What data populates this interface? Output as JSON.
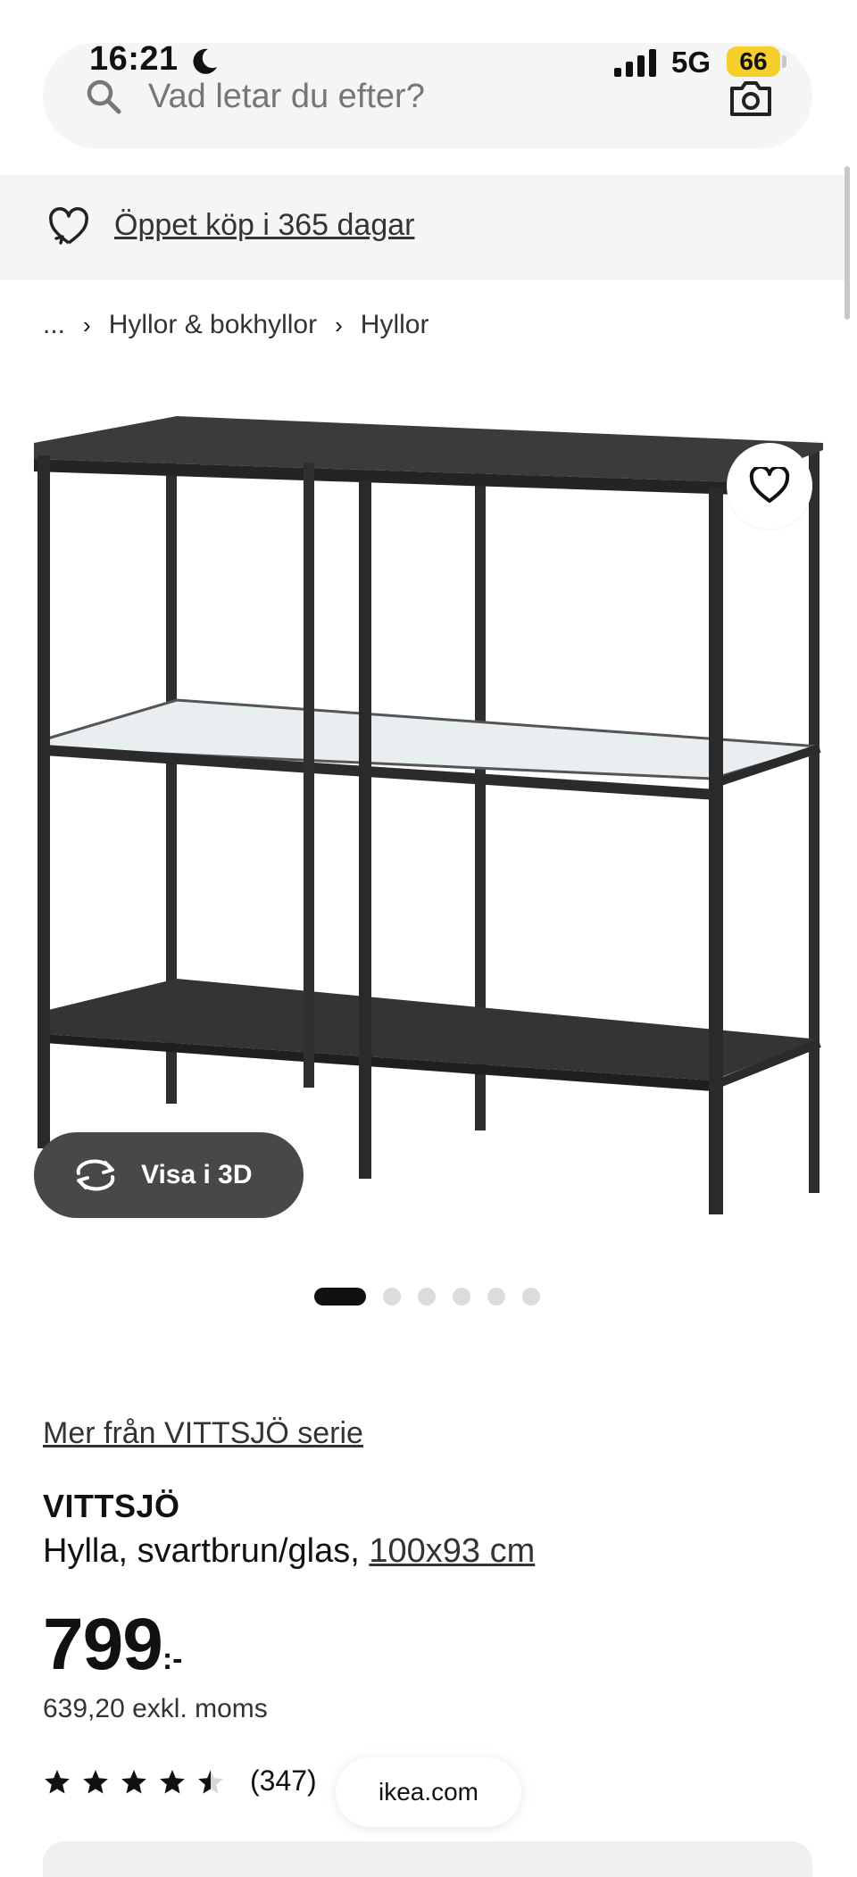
{
  "status_bar": {
    "time": "16:21",
    "network": "5G",
    "battery": "66",
    "battery_color": "#f6cf2c"
  },
  "search": {
    "placeholder": "Vad letar du efter?",
    "icon": "search-icon",
    "camera_icon": "camera-icon"
  },
  "promo": {
    "text": "Öppet köp i 365 dagar",
    "icon": "heart-return-icon"
  },
  "breadcrumb": {
    "items": [
      "...",
      "Hyllor & bokhyllor",
      "Hyllor"
    ]
  },
  "gallery": {
    "view_3d_label": "Visa i 3D",
    "slides_total": 6,
    "active_slide": 1
  },
  "product": {
    "series_link": "Mer från VITTSJÖ serie",
    "name": "VITTSJÖ",
    "description": "Hylla, svartbrun/glas,",
    "size": "100x93 cm",
    "price": "799",
    "price_suffix": ":-",
    "price_ex_vat": "639,20 exkl. moms",
    "rating": 4.5,
    "rating_max": 5,
    "review_count": "(347)"
  },
  "browser": {
    "domain": "ikea.com"
  }
}
